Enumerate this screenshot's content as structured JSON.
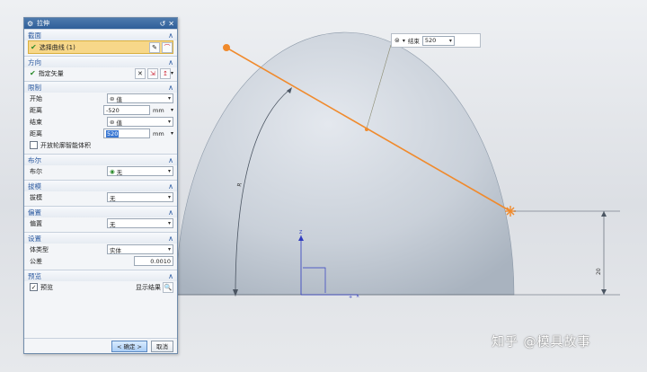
{
  "dialog": {
    "title": "拉伸",
    "sections": {
      "section": {
        "title": "截面",
        "select_curve": "选择曲线 (1)"
      },
      "direction": {
        "title": "方向",
        "specify_vector": "指定矢量"
      },
      "limits": {
        "title": "限制",
        "start_label": "开始",
        "start_value": "值",
        "distance1_label": "距离",
        "distance1_value": "-520",
        "distance1_unit": "mm",
        "end_label": "结束",
        "end_value": "值",
        "distance2_label": "距离",
        "distance2_value": "520",
        "distance2_unit": "mm",
        "open_profile": "开放轮廓智能体积"
      },
      "boolean": {
        "title": "布尔",
        "label": "布尔",
        "value": "无"
      },
      "draft": {
        "title": "拔模",
        "label": "拔模",
        "value": "无"
      },
      "offset": {
        "title": "偏置",
        "label": "偏置",
        "value": "无"
      },
      "settings": {
        "title": "设置",
        "body_type_label": "体类型",
        "body_type_value": "实体",
        "tolerance_label": "公差",
        "tolerance_value": "0.0010"
      },
      "preview": {
        "title": "预览",
        "preview_label": "预览",
        "show_result": "显示结果"
      }
    },
    "ok_label": "< 确定 >",
    "cancel_label": "取消"
  },
  "mini_toolbar": {
    "label": "结束",
    "value": "520"
  },
  "dimensions": {
    "radius_label": "R",
    "height_label": "20"
  },
  "watermark": "知乎 @模具故事",
  "colors": {
    "accent": "#f08a2c",
    "title_bar": "#3a6aa5",
    "section_title": "#2c5aa0"
  }
}
